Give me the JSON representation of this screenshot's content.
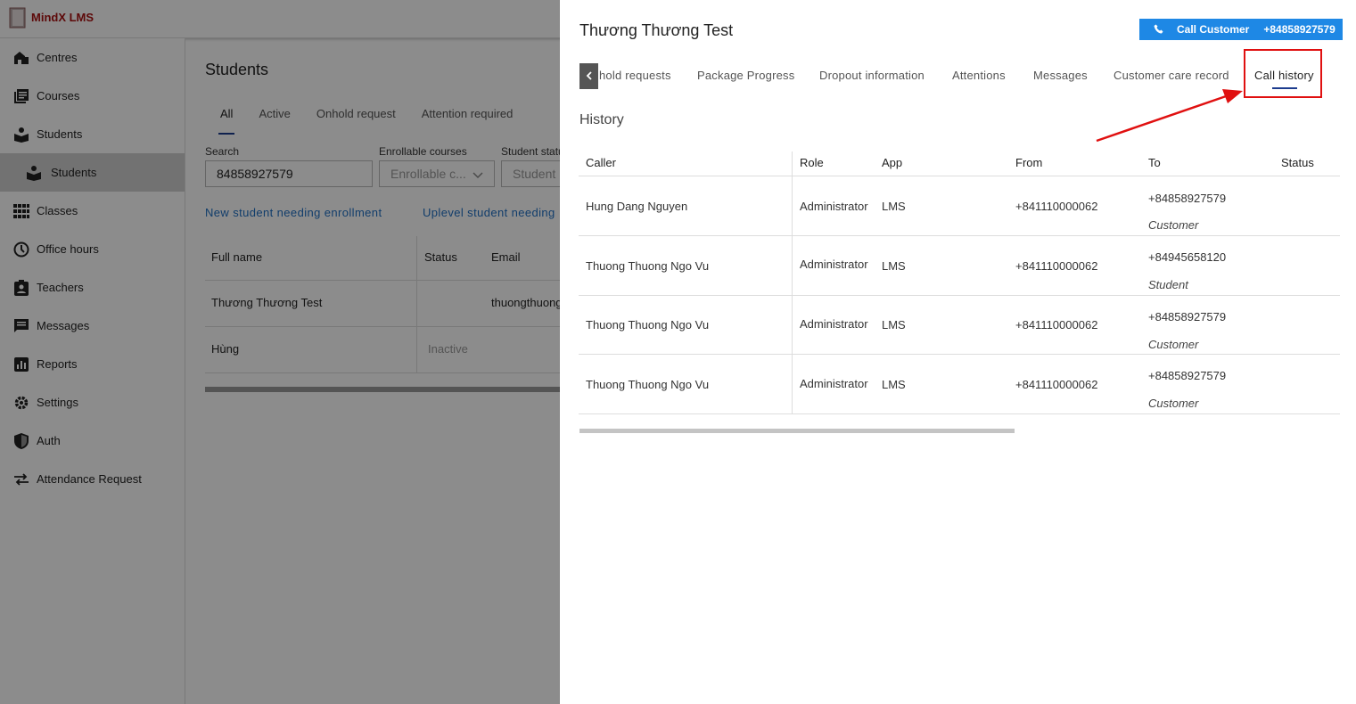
{
  "app": {
    "logo_text": "MindX LMS"
  },
  "sidebar": {
    "items": [
      {
        "label": "Centres",
        "icon": "building-icon"
      },
      {
        "label": "Courses",
        "icon": "book-list-icon"
      },
      {
        "label": "Students",
        "icon": "student-icon"
      },
      {
        "label": "Students",
        "icon": "student-icon",
        "sub": true,
        "active": true
      },
      {
        "label": "Classes",
        "icon": "grid-icon"
      },
      {
        "label": "Office hours",
        "icon": "clock-icon"
      },
      {
        "label": "Teachers",
        "icon": "clipboard-user-icon"
      },
      {
        "label": "Messages",
        "icon": "message-icon"
      },
      {
        "label": "Reports",
        "icon": "chart-icon"
      },
      {
        "label": "Settings",
        "icon": "gear-icon"
      },
      {
        "label": "Auth",
        "icon": "shield-icon"
      },
      {
        "label": "Attendance Request",
        "icon": "swap-arrows-icon"
      }
    ]
  },
  "main": {
    "title": "Students",
    "tabs": [
      "All",
      "Active",
      "Onhold request",
      "Attention required"
    ],
    "filters": {
      "search_label": "Search",
      "search_value": "84858927579",
      "courses_label": "Enrollable courses",
      "courses_placeholder": "Enrollable c...",
      "status_label": "Student statu",
      "status_placeholder": "Student"
    },
    "links": [
      "New student needing enrollment",
      "Uplevel student needing"
    ],
    "table": {
      "headers": [
        "Full name",
        "Status",
        "Email"
      ],
      "rows": [
        {
          "name": "Thương Thương Test",
          "status": "",
          "email": "thuongthuong"
        },
        {
          "name": "Hùng",
          "status": "Inactive",
          "email": ""
        }
      ]
    }
  },
  "drawer": {
    "title": "Thương Thương Test",
    "call_button": {
      "label": "Call Customer",
      "number": "+84858927579"
    },
    "tabs": [
      "hold requests",
      "Package Progress",
      "Dropout information",
      "Attentions",
      "Messages",
      "Customer care record",
      "Call history"
    ],
    "active_tab": "Call history",
    "section_title": "History",
    "table": {
      "headers": [
        "Caller",
        "Role",
        "App",
        "From",
        "To",
        "Status"
      ],
      "rows": [
        {
          "caller": "Hung Dang Nguyen",
          "role": "Administrator",
          "app": "LMS",
          "from": "+841110000062",
          "to": "+84858927579",
          "to_type": "Customer",
          "status": ""
        },
        {
          "caller": "Thuong Thuong Ngo Vu",
          "role": "Administrator",
          "app": "LMS",
          "from": "+841110000062",
          "to": "+84945658120",
          "to_type": "Student",
          "status": ""
        },
        {
          "caller": "Thuong Thuong Ngo Vu",
          "role": "Administrator",
          "app": "LMS",
          "from": "+841110000062",
          "to": "+84858927579",
          "to_type": "Customer",
          "status": ""
        },
        {
          "caller": "Thuong Thuong Ngo Vu",
          "role": "Administrator",
          "app": "LMS",
          "from": "+841110000062",
          "to": "+84858927579",
          "to_type": "Customer",
          "status": ""
        }
      ]
    }
  },
  "colors": {
    "accent": "#1e88e5",
    "tab_underline": "#1d3c8e",
    "annotation": "#e01010",
    "link": "#1f6fc4"
  }
}
